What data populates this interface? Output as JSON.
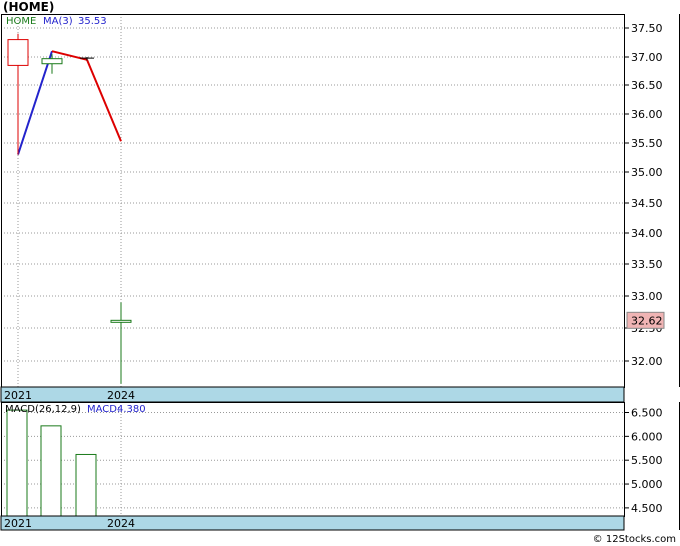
{
  "title": "(HOME)",
  "chart_data": [
    {
      "type": "candlestick",
      "legend": {
        "symbol": "HOME",
        "ma_label": "MA(3)",
        "ma_value": "35.53"
      },
      "x_axis_labels": [
        "2021",
        "2024"
      ],
      "y_ticks": [
        "37.50",
        "37.00",
        "36.50",
        "36.00",
        "35.50",
        "35.00",
        "34.50",
        "34.00",
        "33.50",
        "33.00",
        "32.50",
        "32.00"
      ],
      "ylim": [
        31.6,
        37.75
      ],
      "y_ticks_linear": false,
      "candles": [
        {
          "open": 36.85,
          "high": 37.4,
          "low": 35.3,
          "close": 37.3,
          "color": "#dd0000"
        },
        {
          "open": 36.88,
          "high": 37.05,
          "low": 36.7,
          "close": 36.97,
          "color": "#1a7a1a"
        },
        {
          "open": 36.97,
          "high": 37.0,
          "low": 36.94,
          "close": 36.98,
          "color": "#000000"
        },
        {
          "open": 32.6,
          "high": 32.9,
          "low": 31.65,
          "close": 32.62,
          "color": "#1a7a1a"
        }
      ],
      "moving_average": {
        "name": "MA(3)",
        "points": [
          {
            "x": 0,
            "value": 35.3,
            "color": "#2323cc"
          },
          {
            "x": 1,
            "value": 37.1,
            "color": "#dd0000"
          },
          {
            "x": 2,
            "value": 36.95,
            "color": "#dd0000"
          },
          {
            "x": 3,
            "value": 35.53,
            "color": "#dd0000"
          }
        ]
      },
      "last_price": "32.62",
      "last_price_bg": "#f0b4b4"
    },
    {
      "type": "bar",
      "legend": {
        "indicator": "MACD(26,12,9)",
        "label": "MACD:",
        "value": "4.380"
      },
      "x_axis_labels": [
        "2021",
        "2024"
      ],
      "y_ticks": [
        "6.500",
        "6.000",
        "5.500",
        "5.000",
        "4.500"
      ],
      "ylim": [
        4.33,
        6.72
      ],
      "bars": [
        6.55,
        6.22,
        5.62
      ],
      "bar_color": "#1a7a1a"
    }
  ],
  "footer": {
    "copyright": "© 12Stocks.com"
  },
  "colors": {
    "axis_band": "#add8e6",
    "grid": "#999999"
  }
}
